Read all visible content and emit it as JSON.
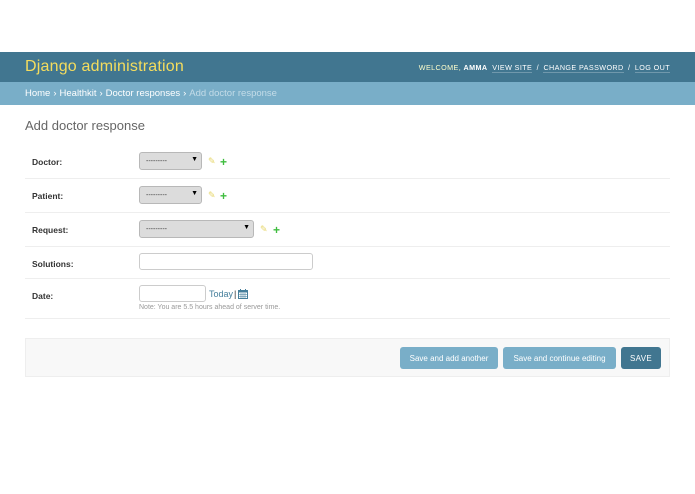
{
  "header": {
    "branding": "Django administration",
    "welcome": "Welcome,",
    "username": "AMMA",
    "view_site": "View site",
    "change_password": "Change password",
    "log_out": "Log out",
    "separator": "/"
  },
  "breadcrumbs": {
    "home": "Home",
    "app": "Healthkit",
    "model": "Doctor responses",
    "current": "Add doctor response",
    "separator": "›"
  },
  "page": {
    "title": "Add doctor response"
  },
  "form": {
    "doctor": {
      "label": "Doctor:",
      "value": "---------"
    },
    "patient": {
      "label": "Patient:",
      "value": "---------"
    },
    "request": {
      "label": "Request:",
      "value": "---------"
    },
    "solutions": {
      "label": "Solutions:",
      "value": ""
    },
    "date": {
      "label": "Date:",
      "value": "",
      "today": "Today",
      "pipe": "|",
      "help": "Note: You are 5.5 hours ahead of server time."
    }
  },
  "icons": {
    "edit": "pencil-icon",
    "add": "plus-icon",
    "calendar": "calendar-icon",
    "dropdown": "caret-down-icon"
  },
  "submit": {
    "save_add_another": "Save and add another",
    "save_continue": "Save and continue editing",
    "save": "SAVE"
  },
  "colors": {
    "header": "#417690",
    "breadcrumbs": "#79aec8",
    "branding": "#f5dd5d",
    "add": "#3fbd3f",
    "edit": "#e6d66a"
  }
}
